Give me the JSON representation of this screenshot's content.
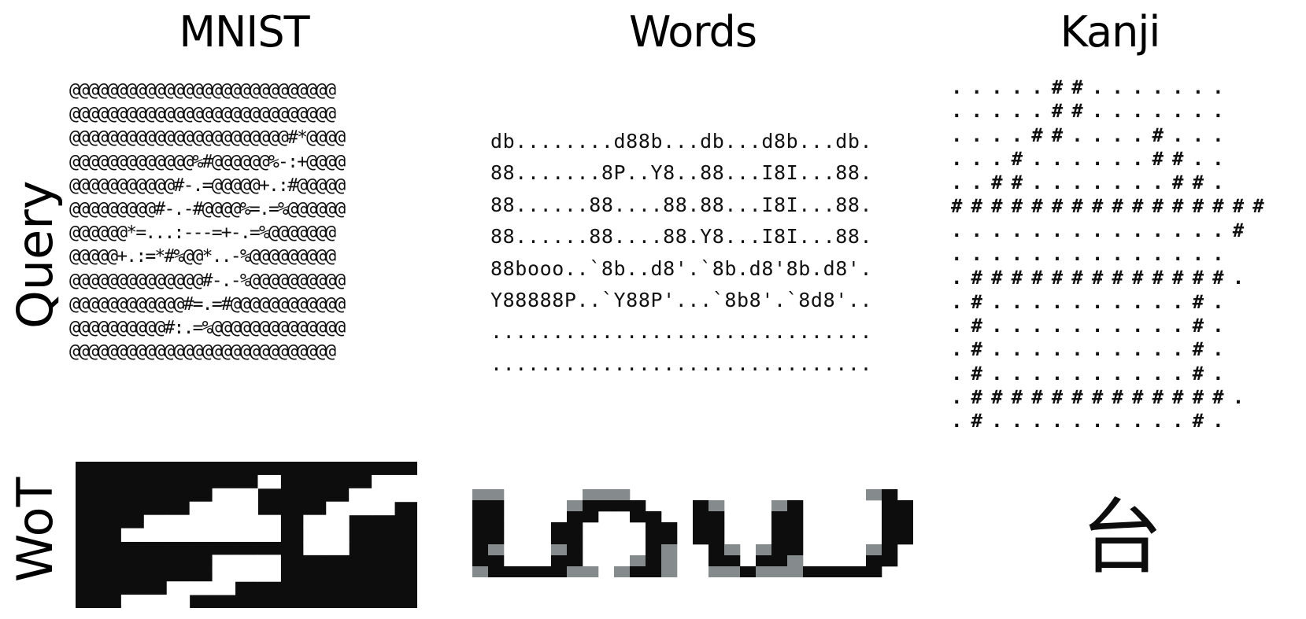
{
  "columns": {
    "mnist": "MNIST",
    "words": "Words",
    "kanji": "Kanji"
  },
  "rows": {
    "query": "Query",
    "wot": "WoT"
  },
  "query": {
    "mnist": [
      "@@@@@@@@@@@@@@@@@@@@@@@@@@@@",
      "@@@@@@@@@@@@@@@@@@@@@@@@@@@@",
      "@@@@@@@@@@@@@@@@@@@@@@@#*@@@@",
      "@@@@@@@@@@@@@%#@@@@@@%-:+@@@@",
      "@@@@@@@@@@@#-.=@@@@@+.:#@@@@@",
      "@@@@@@@@@#-.-#@@@@%=.=%@@@@@@",
      "@@@@@@*=...:---=+-.=%@@@@@@@",
      "@@@@@+.:=*#%@@*..-%@@@@@@@@@",
      "@@@@@@@@@@@@@@#-.-%@@@@@@@@@@",
      "@@@@@@@@@@@@#=.=#@@@@@@@@@@@@",
      "@@@@@@@@@@#:.=%@@@@@@@@@@@@@@",
      "@@@@@@@@@@@@@@@@@@@@@@@@@@@@"
    ],
    "words": [
      "db........d88b...db...d8b...db.",
      "88.......8P..Y8..88...I8I...88.",
      "88......88....88.88...I8I...88.",
      "88......88....88.Y8...I8I...88.",
      "88booo..`8b..d8'.`8b.d8'8b.d8'.",
      "Y88888P..`Y88P'...`8b8'.`8d8'..",
      "...............................",
      "..............................."
    ],
    "kanji": [
      ".....##.......",
      ".....##.......",
      "....##....#...",
      "...#......##..",
      "..##.......##.",
      "################",
      "..............#",
      "..............",
      ".#############.",
      ".#..........#.",
      ".#..........#.",
      ".#..........#.",
      ".#..........#.",
      ".#############.",
      ".#..........#."
    ]
  },
  "wot": {
    "mnist": {
      "rows": [
        "...............",
        "........#....##",
        "......##....###",
        ".....###...###.",
        "...######.##...",
        "..#######.##...",
        "..........##...",
        "......###......",
        "......###......",
        "....###........",
        "..###.........."
      ],
      "bg": "#0d0d0d",
      "fg": "#ffffff"
    },
    "words": {
      "rows": [
        "gg.....ggg...............gb.",
        "bb....gbbbb...bg...gb.....bb",
        "bb....bb..bb..bb...bb.....bb",
        "bb...bb....bb.bb...bb.....bb",
        "bb...bb....bb.bb...bb.....bb",
        "bg...gb....bg..bg.gbb....gb.",
        "bb...bb...gbg..bb.bbg....bb.",
        "gbbbbbgg.gbbg..ggbgggbbbbb.."
      ],
      "colors": {
        "b": "#0d0d0d",
        "g": "#858a8c"
      }
    },
    "kanji": {
      "glyph": "台"
    }
  }
}
